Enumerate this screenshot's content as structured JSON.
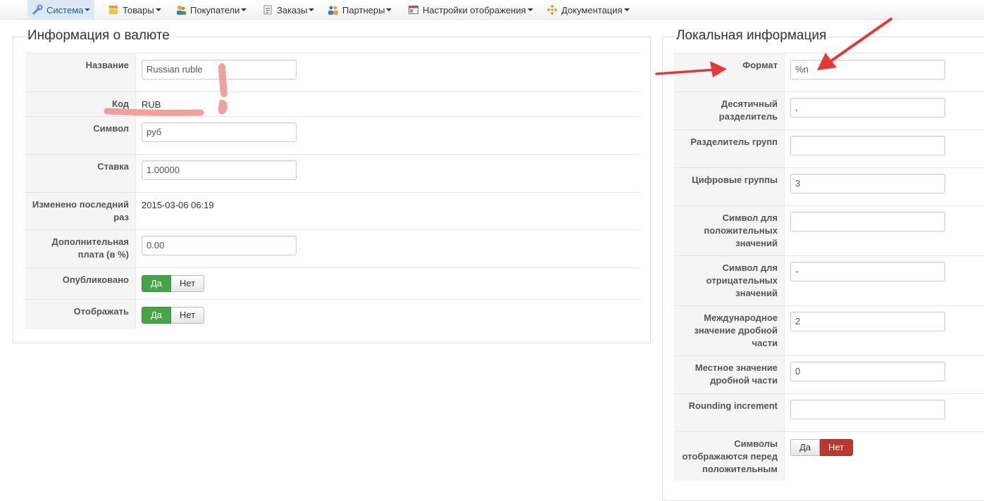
{
  "menu": [
    {
      "label": "Система",
      "icon": "wrench-icon",
      "active": true
    },
    {
      "label": "Товары",
      "icon": "box-icon",
      "active": false
    },
    {
      "label": "Покупатели",
      "icon": "users-icon",
      "active": false
    },
    {
      "label": "Заказы",
      "icon": "orders-icon",
      "active": false
    },
    {
      "label": "Партнеры",
      "icon": "partners-icon",
      "active": false
    },
    {
      "label": "Настройки отображения",
      "icon": "display-settings-icon",
      "active": false
    },
    {
      "label": "Документация",
      "icon": "docs-icon",
      "active": false
    }
  ],
  "currency_info": {
    "legend": "Информация о валюте",
    "name_label": "Название",
    "name_value": "Russian ruble",
    "code_label": "Код",
    "code_value": "RUB",
    "symbol_label": "Символ",
    "symbol_value": "руб",
    "rate_label": "Ставка",
    "rate_value": "1.00000",
    "modified_label": "Изменено последний раз",
    "modified_value": "2015-03-06 06:19",
    "surcharge_label": "Дополнительная плата (в %)",
    "surcharge_value": "0.00",
    "published_label": "Опубликовано",
    "published_yes": "Да",
    "published_no": "Нет",
    "display_label": "Отображать",
    "display_yes": "Да",
    "display_no": "Нет"
  },
  "local_info": {
    "legend": "Локальная информация",
    "format_label": "Формат",
    "format_value": "%n",
    "decimal_sep_label": "Десятичный разделитель",
    "decimal_sep_value": ",",
    "group_sep_label": "Разделитель групп",
    "group_sep_value": "",
    "digit_groups_label": "Цифровые группы",
    "digit_groups_value": "3",
    "positive_symbol_label": "Символ для положительных значений",
    "positive_symbol_value": "",
    "negative_symbol_label": "Символ для отрицательных значений",
    "negative_symbol_value": "-",
    "intl_frac_label": "Международное значение дробной части",
    "intl_frac_value": "2",
    "local_frac_label": "Местное значение дробной части",
    "local_frac_value": "0",
    "rounding_label": "Rounding increment",
    "rounding_value": "",
    "symbols_before_label": "Символы отображаются перед положительным",
    "symbols_before_yes": "Да",
    "symbols_before_no": "Нет"
  },
  "colors": {
    "active_menu_bg": "#dce9f5",
    "toggle_green": "#46a546",
    "toggle_red": "#bd362f",
    "annotation_red": "#e53935"
  }
}
